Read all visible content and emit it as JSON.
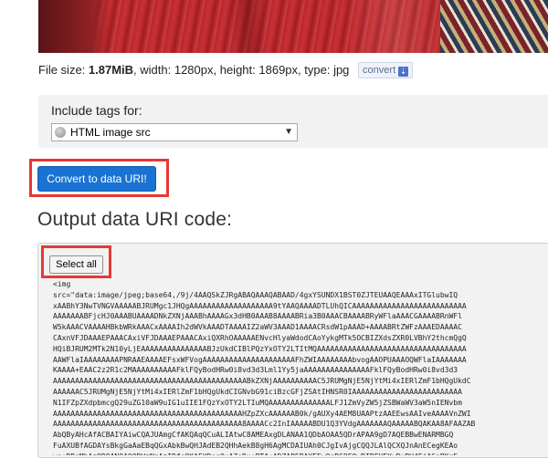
{
  "file_info": {
    "size_label": "File size: ",
    "size_value": "1.87MiB",
    "width_label": ", width: ",
    "width_value": "1280px",
    "height_label": ", height: ",
    "height_value": "1869px",
    "type_label": ", type: ",
    "type_value": "jpg",
    "convert_label": "convert",
    "convert_icon": "download-icon"
  },
  "tags": {
    "label": "Include tags for:",
    "selected": "HTML image src",
    "select_icon": "globe-icon"
  },
  "convert_button": {
    "label": "Convert to data URI!"
  },
  "output": {
    "heading": "Output data URI code:",
    "select_all_label": "Select all",
    "code_lines": [
      "<img",
      "src=\"data:image/jpeg;base64,/9j/4AAQSkZJRgABAQAAAQABAAD/4gxYSUNDX1BST0ZJTEUAAQEAAAxITGlubwIQ",
      "xAABhY3NwTVNGVAAAAABJRUMgc1JHQgAAAAAAAAAAAAAAAAAAA9tYAAQAAAADTLUhQICAAAAAAAAAAAAAAAAAAAAAAAAAA",
      "AAAAAAABFjcHJ0AAABUAAAADNkZXNjAAABhAAAAGx3dHB0AAAB8AAAABRia3B0AAACBAAAABRyWFlaAAACGAAAABRnWFl",
      "W5kAAACVAAAAHBkbWRkAAACxAAAAIh2dWVkAAADTAAAAIZ2aWV3AAAD1AAAACRsdW1pAAAD+AAAABRtZWFzAAAEDAAAAC",
      "CAxnVFJDAAAEPAAACAxiVFJDAAAEPAAACAxiQXRhOAAAAAENvcHlyaWdodCAoYykgMTk5OCBIZXdsZXR0LVBhY2thcmQgQ",
      "HQiBJRUM2MTk2N10yLjEAAAAAAAAAAAAAAABJzUkdCIBlPQzYxOTY2LTItMQAAAAAAAAAAAAAAAAAAAAAAAAAAAAAAAAAA",
      "AAWFlaIAAAAAAAAPNRAAEAAAAEFsxWFVogAAAAAAAAAAAAAAAAAAAAAFhZWIAAAAAAAAbvogAAOPUAAAOQWFlaIAAAAAAA",
      "KAAAA+EAAC2z2R1c2MAAAAAAAAAAFklFQyBodHRw0i8vd3d3Lml1Yy5jaAAAAAAAAAAAAAAAFklFQyBodHRw0i8vd3d3",
      "AAAAAAAAAAAAAAAAAAAAAAAAAAAAAAAAAAAAAAAAAAAABkZXNjAAAAAAAAAAC5JRUMgNjE5NjYtMi4xIERlZmF1bHQgUkdC",
      "AAAAAAC5JRUMgNjE5NjYtMi4xIERlZmF1bHQgUkdCIGNvbG91ciBzcGFjZSAtIHNSR0IAAAAAAAAAAAAAAAAAAAAAAAAA",
      "N1IFZpZXdpbmcgQ29uZG10aW9uIG1uIIE1FQzYxOTY2LTIuMQAAAAAAAAAAAAAALFJ1ZmVyZW5jZSBWaWV3aW5nIENvbm",
      "AAAAAAAAAAAAAAAAAAAAAAAAAAAAAAAAAAAAAAAAAAAHZpZXcAAAAAAB0k/gAUXy4AEM8UAAPtzAAEEwsAAIveAAAAVnZWI",
      "AAAAAAAAAAAAAAAAAAAAAAAAAAAAAAAAAAAAAAAAAAA8AAAACc2InIAAAAABDU1Q3YVdgAAAAAAAQAAAAABQAKAA8AFAAZAB",
      "AbQByAHcAfACBAIYAiwCQAJUAmgCfAKQAqQCuALIAtwC8AMEAxgDLANAA1QDbAOAA5QDrAPAA9gD7AQEBBwENARMBGQ",
      "FuAXUBfAGDAYsBkgGaAaEBqQGxAbkBwQHJAdEB2QHhAekB8gH6AgMCDAIUAh0CJgIvAjgCQQJLAlQCXQJnAnECegKEAo",
      "ws+DRgMhAzQDOAN0A0QDWzNmAzIDfgOKA5YDogOuA7oDx+PTA+ADZAP5BAYEEwQgBC0EOwRIBFUEYwRxBH4EjASaBKgE"
    ]
  }
}
